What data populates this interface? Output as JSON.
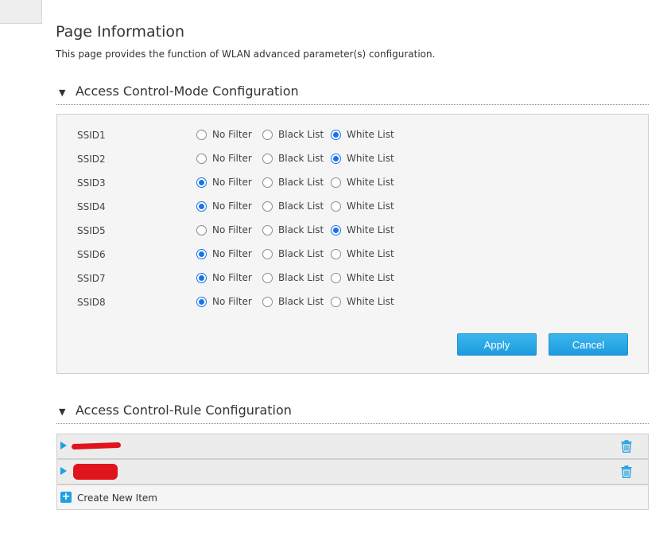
{
  "page": {
    "title": "Page Information",
    "description": "This page provides the function of WLAN advanced parameter(s) configuration."
  },
  "mode_section": {
    "title": "Access Control-Mode Configuration",
    "options": [
      "No Filter",
      "Black List",
      "White List"
    ],
    "rows": [
      {
        "ssid": "SSID1",
        "selected": "White List"
      },
      {
        "ssid": "SSID2",
        "selected": "White List"
      },
      {
        "ssid": "SSID3",
        "selected": "No Filter"
      },
      {
        "ssid": "SSID4",
        "selected": "No Filter"
      },
      {
        "ssid": "SSID5",
        "selected": "White List"
      },
      {
        "ssid": "SSID6",
        "selected": "No Filter"
      },
      {
        "ssid": "SSID7",
        "selected": "No Filter"
      },
      {
        "ssid": "SSID8",
        "selected": "No Filter"
      }
    ],
    "apply_label": "Apply",
    "cancel_label": "Cancel"
  },
  "rule_section": {
    "title": "Access Control-Rule Configuration",
    "rules": [
      {
        "name": "",
        "redacted": true
      },
      {
        "name": "",
        "redacted": true
      }
    ],
    "create_label": "Create New Item"
  },
  "colors": {
    "accent": "#1fa0e0",
    "radio_checked": "#1a73e8",
    "button": "#2aa9e8",
    "redaction": "#e0141c"
  }
}
